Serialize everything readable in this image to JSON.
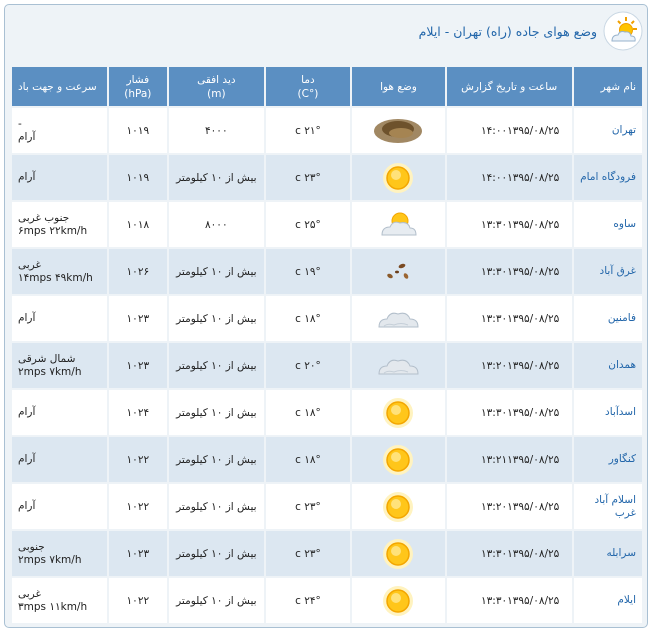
{
  "header": {
    "title": "وضع هوای جاده (راه) تهران - ایلام",
    "icon": "sun-cloud-icon"
  },
  "columns": [
    "نام شهر",
    "ساعت و تاریخ گزارش",
    "وضع هوا",
    "دما\n(°C)",
    "دید افقی\n(m)",
    "فشار\n(hPa)",
    "سرعت و جهت باد"
  ],
  "rows": [
    {
      "city": "تهران",
      "time": "۱۴:۰۰",
      "date": "۱۳۹۵/۰۸/۲۵",
      "weather": "dust-icon",
      "temp": "۲۱° c",
      "visibility": "۴۰۰۰",
      "pressure": "۱۰۱۹",
      "wind1": "-",
      "wind2": "آرام"
    },
    {
      "city": "فرودگاه امام",
      "time": "۱۴:۰۰",
      "date": "۱۳۹۵/۰۸/۲۵",
      "weather": "sun-icon",
      "temp": "۲۳° c",
      "visibility": "بیش از ۱۰ کیلومتر",
      "pressure": "۱۰۱۹",
      "wind1": "",
      "wind2": "آرام"
    },
    {
      "city": "ساوه",
      "time": "۱۳:۳۰",
      "date": "۱۳۹۵/۰۸/۲۵",
      "weather": "partly-cloudy-icon",
      "temp": "۲۵° c",
      "visibility": "۸۰۰۰",
      "pressure": "۱۰۱۸",
      "wind1": "جنوب غربی",
      "wind2": "۶mps ۲۲km/h"
    },
    {
      "city": "غرق آباد",
      "time": "۱۳:۳۰",
      "date": "۱۳۹۵/۰۸/۲۵",
      "weather": "leaves-icon",
      "temp": "۱۹° c",
      "visibility": "بیش از ۱۰ کیلومتر",
      "pressure": "۱۰۲۶",
      "wind1": "غربی",
      "wind2": "۱۴mps ۴۹km/h"
    },
    {
      "city": "فامنین",
      "time": "۱۳:۳۰",
      "date": "۱۳۹۵/۰۸/۲۵",
      "weather": "cloud-icon",
      "temp": "۱۸° c",
      "visibility": "بیش از ۱۰ کیلومتر",
      "pressure": "۱۰۲۳",
      "wind1": "",
      "wind2": "آرام"
    },
    {
      "city": "همدان",
      "time": "۱۳:۲۰",
      "date": "۱۳۹۵/۰۸/۲۵",
      "weather": "cloud-icon",
      "temp": "۲۰° c",
      "visibility": "بیش از ۱۰ کیلومتر",
      "pressure": "۱۰۲۳",
      "wind1": "شمال شرقی",
      "wind2": "۲mps ۷km/h"
    },
    {
      "city": "اسدآباد",
      "time": "۱۳:۳۰",
      "date": "۱۳۹۵/۰۸/۲۵",
      "weather": "sun-icon",
      "temp": "۱۸° c",
      "visibility": "بیش از ۱۰ کیلومتر",
      "pressure": "۱۰۲۴",
      "wind1": "",
      "wind2": "آرام"
    },
    {
      "city": "کنگاور",
      "time": "۱۳:۲۱",
      "date": "۱۳۹۵/۰۸/۲۵",
      "weather": "sun-icon",
      "temp": "۱۸° c",
      "visibility": "بیش از ۱۰ کیلومتر",
      "pressure": "۱۰۲۲",
      "wind1": "",
      "wind2": "آرام"
    },
    {
      "city": "اسلام آباد غرب",
      "time": "۱۳:۲۰",
      "date": "۱۳۹۵/۰۸/۲۵",
      "weather": "sun-icon",
      "temp": "۲۳° c",
      "visibility": "بیش از ۱۰ کیلومتر",
      "pressure": "۱۰۲۲",
      "wind1": "",
      "wind2": "آرام"
    },
    {
      "city": "سرابله",
      "time": "۱۳:۳۰",
      "date": "۱۳۹۵/۰۸/۲۵",
      "weather": "sun-icon",
      "temp": "۲۳° c",
      "visibility": "بیش از ۱۰ کیلومتر",
      "pressure": "۱۰۲۳",
      "wind1": "جنوبی",
      "wind2": "۲mps ۷km/h"
    },
    {
      "city": "ایلام",
      "time": "۱۳:۳۰",
      "date": "۱۳۹۵/۰۸/۲۵",
      "weather": "sun-icon",
      "temp": "۲۴° c",
      "visibility": "بیش از ۱۰ کیلومتر",
      "pressure": "۱۰۲۲",
      "wind1": "غربی",
      "wind2": "۳mps ۱۱km/h"
    }
  ],
  "colors": {
    "header_bg": "#5b8fc2",
    "link": "#2266aa",
    "row_alt": "#dce7f1",
    "panel_bg": "#eef3f7"
  }
}
